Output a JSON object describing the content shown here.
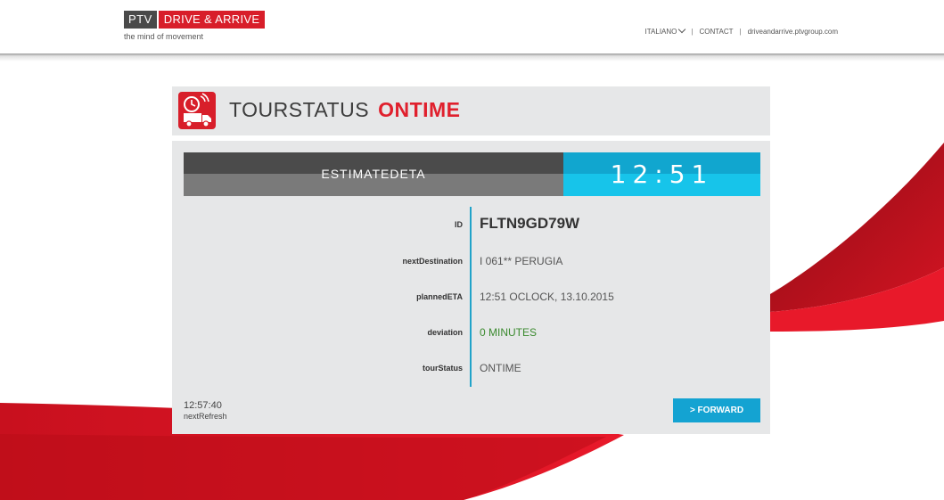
{
  "header": {
    "logo_ptv": "PTV",
    "logo_brand": "DRIVE & ARRIVE",
    "tagline": "the mind of movement",
    "nav": {
      "language": "ITALIANO",
      "separator": "|",
      "contact": "CONTACT",
      "site": "driveandarrive.ptvgroup.com"
    }
  },
  "status": {
    "title": "TOURSTATUS",
    "value": "ONTIME",
    "icon": "truck-clock-icon"
  },
  "eta": {
    "label": "ESTIMATEDETA",
    "time": "12:51"
  },
  "details": [
    {
      "label": "ID",
      "value": "FLTN9GD79W"
    },
    {
      "label": "nextDestination",
      "value": "I 061** PERUGIA"
    },
    {
      "label": "plannedETA",
      "value": "12:51 OCLOCK, 13.10.2015"
    },
    {
      "label": "deviation",
      "value": "0 MINUTES"
    },
    {
      "label": "tourStatus",
      "value": "ONTIME"
    }
  ],
  "refresh": {
    "time": "12:57:40",
    "label": "nextRefresh"
  },
  "forward_button": "> FORWARD",
  "colors": {
    "brand_red": "#d81e2a",
    "accent_blue": "#17c4ea",
    "ontime_red": "#e0202d",
    "deviation_green": "#3b8a2f"
  }
}
